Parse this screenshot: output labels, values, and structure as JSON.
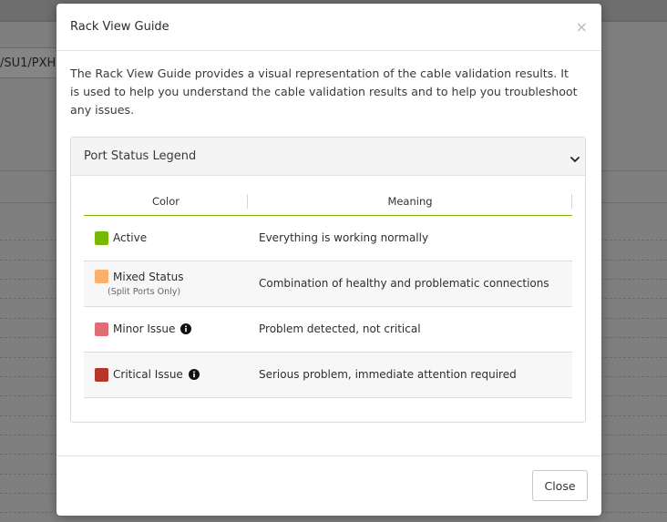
{
  "background": {
    "path_text": "/SU1/PXH"
  },
  "modal": {
    "title": "Rack View Guide",
    "close_glyph": "×",
    "intro": "The Rack View Guide provides a visual representation of the cable validation results. It is used to help you understand the cable validation results and to help you troubleshoot any issues.",
    "panel": {
      "title": "Port Status Legend",
      "expanded": true,
      "columns": [
        "Color",
        "Meaning"
      ],
      "rows": [
        {
          "label": "Active",
          "sublabel": "",
          "color": "#76b900",
          "info": false,
          "meaning": "Everything is working normally"
        },
        {
          "label": "Mixed Status",
          "sublabel": "(Split Ports Only)",
          "color": "#f6b26b",
          "info": false,
          "meaning": "Combination of healthy and problematic connections"
        },
        {
          "label": "Minor Issue",
          "sublabel": "",
          "color": "#e06c75",
          "info": true,
          "meaning": "Problem detected, not critical"
        },
        {
          "label": "Critical Issue",
          "sublabel": "",
          "color": "#b5352b",
          "info": true,
          "meaning": "Serious problem, immediate attention required"
        }
      ]
    },
    "footer": {
      "close_label": "Close"
    }
  },
  "colors": {
    "accent": "#76b900",
    "overlay": "#7f7f7f"
  }
}
